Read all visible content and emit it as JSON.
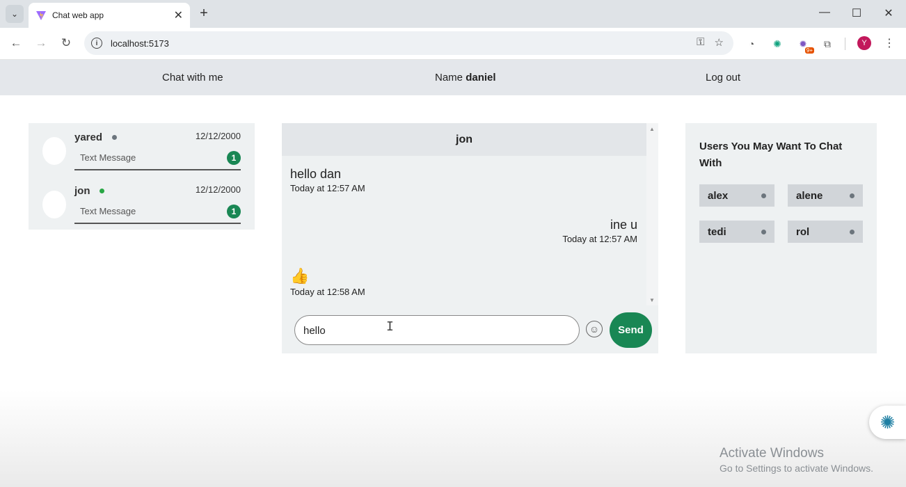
{
  "browser": {
    "tab_title": "Chat web app",
    "url": "localhost:5173",
    "profile_initial": "Y",
    "extension_badge": "9+"
  },
  "nav": {
    "brand": "Chat with me",
    "name_label": "Name",
    "user_name": "daniel",
    "logout": "Log out"
  },
  "chats": [
    {
      "name": "yared",
      "online": false,
      "date": "12/12/2000",
      "preview": "Text Message",
      "unread": "1"
    },
    {
      "name": "jon",
      "online": true,
      "date": "12/12/2000",
      "preview": "Text Message",
      "unread": "1"
    }
  ],
  "chatbox": {
    "recipient": "jon",
    "messages": [
      {
        "text": "hello dan",
        "time": "Today at 12:57 AM",
        "side": "left"
      },
      {
        "text": "ine u",
        "time": "Today at 12:57 AM",
        "side": "right"
      },
      {
        "text": "👍",
        "time": "Today at 12:58 AM",
        "side": "left"
      }
    ],
    "input_value": "hello",
    "send_label": "Send"
  },
  "suggestions": {
    "title": "Users You May Want To Chat With",
    "users": [
      "alex",
      "alene",
      "tedi",
      "rol"
    ]
  },
  "watermark": {
    "line1": "Activate Windows",
    "line2": "Go to Settings to activate Windows."
  },
  "colors": {
    "accent_green": "#198754",
    "online_dot": "#28a745",
    "offline_dot": "#6c757d",
    "nav_bg": "#e4e7eb",
    "panel_bg": "#eef1f2"
  }
}
